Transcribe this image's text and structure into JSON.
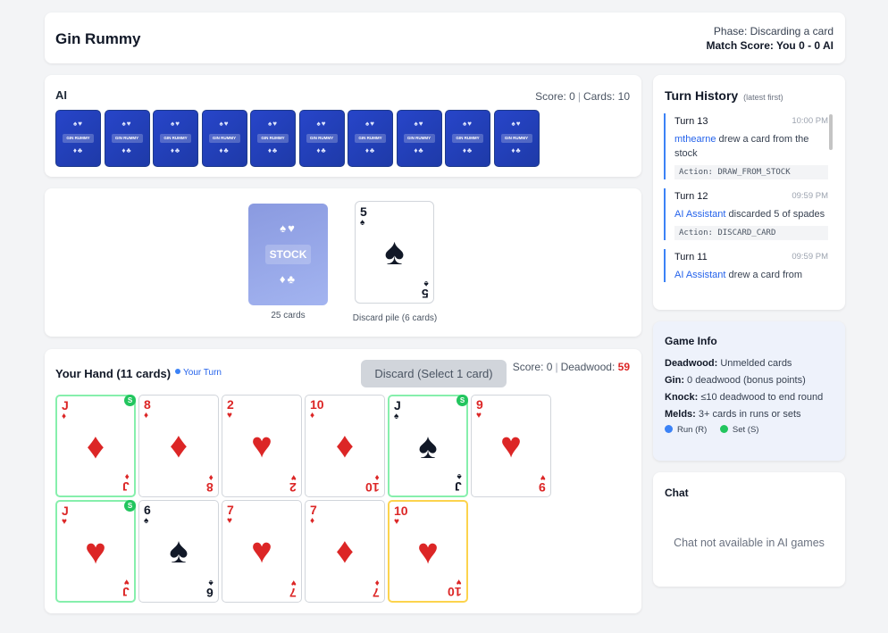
{
  "header": {
    "title": "Gin Rummy",
    "phase": "Phase: Discarding a card",
    "match_score": "Match Score: You 0 - 0 AI"
  },
  "ai": {
    "title": "AI",
    "score": "Score: 0",
    "cards": "Cards: 10",
    "card_back_label": "GIN RUMMY",
    "card_back_suits_top": "♠♥",
    "card_back_suits_bottom": "♦♣",
    "card_count": 10
  },
  "table": {
    "stock_label": "STOCK",
    "stock_suits_top": "♠♥",
    "stock_suits_bottom": "♦♣",
    "stock_caption": "25 cards",
    "discard_caption": "Discard pile (6 cards)",
    "discard_top": {
      "rank": "5",
      "suit": "♠",
      "color": "black"
    }
  },
  "hand": {
    "title": "Your Hand (11 cards)",
    "turn_indicator": "Your Turn",
    "discard_button": "Discard (Select 1 card)",
    "score": "Score: 0",
    "deadwood_label": "Deadwood:",
    "deadwood_value": "59",
    "meld_badge": "S",
    "cards": [
      {
        "rank": "J",
        "suit": "♦",
        "color": "red",
        "meld": "S",
        "highlight": "green"
      },
      {
        "rank": "8",
        "suit": "♦",
        "color": "red",
        "meld": "",
        "highlight": ""
      },
      {
        "rank": "2",
        "suit": "♥",
        "color": "red",
        "meld": "",
        "highlight": ""
      },
      {
        "rank": "10",
        "suit": "♦",
        "color": "red",
        "meld": "",
        "highlight": ""
      },
      {
        "rank": "J",
        "suit": "♠",
        "color": "black",
        "meld": "S",
        "highlight": "green"
      },
      {
        "rank": "9",
        "suit": "♥",
        "color": "red",
        "meld": "",
        "highlight": ""
      },
      {
        "rank": "J",
        "suit": "♥",
        "color": "red",
        "meld": "S",
        "highlight": "green"
      },
      {
        "rank": "6",
        "suit": "♠",
        "color": "black",
        "meld": "",
        "highlight": ""
      },
      {
        "rank": "7",
        "suit": "♥",
        "color": "red",
        "meld": "",
        "highlight": ""
      },
      {
        "rank": "7",
        "suit": "♦",
        "color": "red",
        "meld": "",
        "highlight": ""
      },
      {
        "rank": "10",
        "suit": "♥",
        "color": "red",
        "meld": "",
        "highlight": "yellow"
      }
    ]
  },
  "history": {
    "title": "Turn History",
    "subtitle": "(latest first)",
    "entries": [
      {
        "turn": "Turn 13",
        "time": "10:00 PM",
        "who": "mthearne",
        "text": " drew a card from the stock",
        "action": "Action: DRAW_FROM_STOCK"
      },
      {
        "turn": "Turn 12",
        "time": "09:59 PM",
        "who": "AI Assistant",
        "text": " discarded 5 of spades",
        "action": "Action: DISCARD_CARD"
      },
      {
        "turn": "Turn 11",
        "time": "09:59 PM",
        "who": "AI Assistant",
        "text": " drew a card from",
        "action": ""
      }
    ]
  },
  "info": {
    "title": "Game Info",
    "deadwood_label": "Deadwood:",
    "deadwood_text": " Unmelded cards",
    "gin_label": "Gin:",
    "gin_text": " 0 deadwood (bonus points)",
    "knock_label": "Knock:",
    "knock_text": " ≤10 deadwood to end round",
    "melds_label": "Melds:",
    "melds_text": " 3+ cards in runs or sets",
    "legend_run": "Run (R)",
    "legend_set": "Set (S)",
    "run_color": "#3b82f6",
    "set_color": "#22c55e"
  },
  "chat": {
    "title": "Chat",
    "message": "Chat not available in AI games"
  }
}
